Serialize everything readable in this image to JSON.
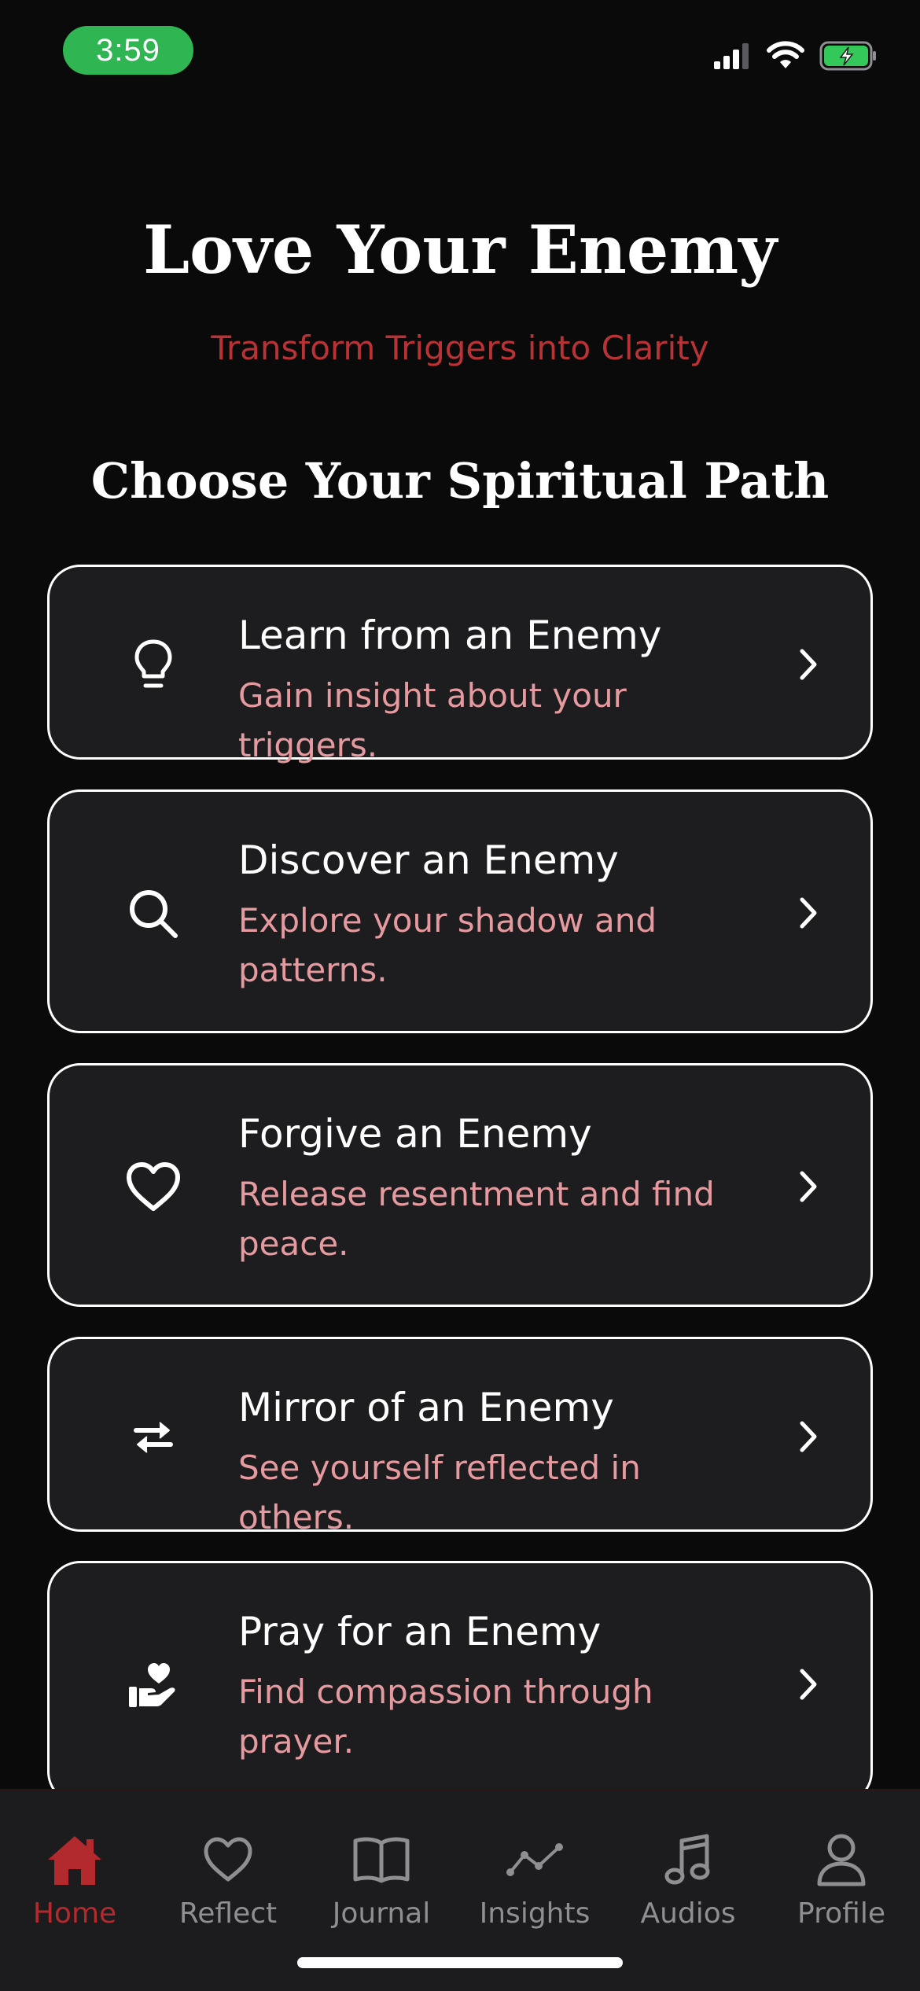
{
  "status_bar": {
    "time": "3:59",
    "icons": [
      "cellular-signal-icon",
      "wifi-icon",
      "battery-charging-icon"
    ],
    "time_pill_color": "#2fb552"
  },
  "header": {
    "title": "Love Your Enemy",
    "subtitle": "Transform Triggers into Clarity"
  },
  "section_title": "Choose Your Spiritual Path",
  "paths": [
    {
      "icon": "lightbulb-icon",
      "title": "Learn from an Enemy",
      "description": "Gain insight about your triggers."
    },
    {
      "icon": "search-icon",
      "title": "Discover an Enemy",
      "description": "Explore your shadow and patterns."
    },
    {
      "icon": "heart-icon",
      "title": "Forgive an Enemy",
      "description": "Release resentment and find peace."
    },
    {
      "icon": "arrows-exchange-icon",
      "title": "Mirror of an Enemy",
      "description": "See yourself reflected in others."
    },
    {
      "icon": "hand-heart-icon",
      "title": "Pray for an Enemy",
      "description": "Find compassion through prayer."
    }
  ],
  "bottom_nav": {
    "items": [
      {
        "label": "Home",
        "icon": "home-icon",
        "active": true
      },
      {
        "label": "Reflect",
        "icon": "heart-icon",
        "active": false
      },
      {
        "label": "Journal",
        "icon": "book-icon",
        "active": false
      },
      {
        "label": "Insights",
        "icon": "chart-line-icon",
        "active": false
      },
      {
        "label": "Audios",
        "icon": "music-note-icon",
        "active": false
      },
      {
        "label": "Profile",
        "icon": "user-icon",
        "active": false
      }
    ]
  },
  "colors": {
    "background": "#0a0a0b",
    "card_background": "#1d1d1f",
    "accent_red": "#b83236",
    "description_pink": "#e59a9f",
    "inactive_gray": "#8e8e93"
  }
}
